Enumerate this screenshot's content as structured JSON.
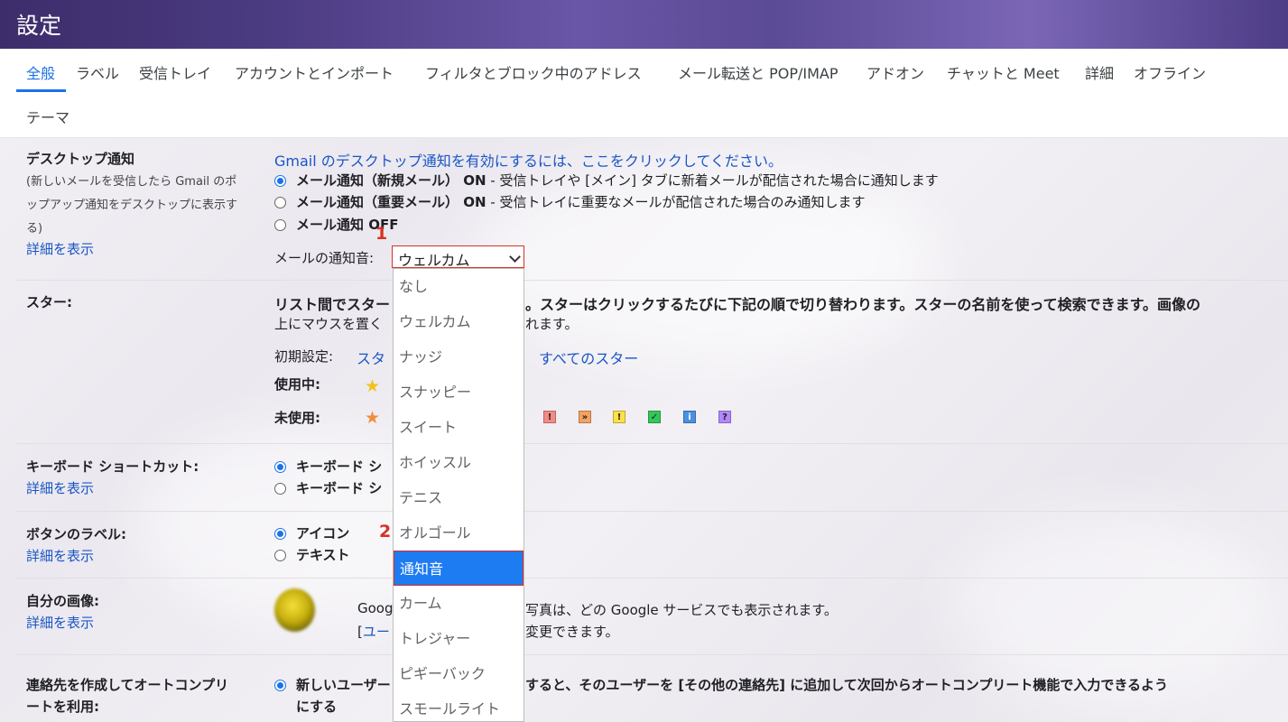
{
  "header": {
    "title": "設定"
  },
  "tabs": [
    "全般",
    "ラベル",
    "受信トレイ",
    "アカウントとインポート",
    "フィルタとブロック中のアドレス",
    "メール転送と POP/IMAP",
    "アドオン",
    "チャットと Meet",
    "詳細",
    "オフライン",
    "テーマ"
  ],
  "desktop": {
    "label": "デスクトップ通知",
    "desc1": "(新しいメールを受信したら Gmail のポ",
    "desc2": "ップアップ通知をデスクトップに表示す",
    "desc3": "る)",
    "more": "詳細を表示",
    "enable_link": "Gmail のデスクトップ通知を有効にするには、ここをクリックしてください。",
    "opt1_b": "メール通知（新規メール） ON",
    "opt1_t": " - 受信トレイや [メイン] タブに新着メールが配信された場合に通知します",
    "opt2_b": "メール通知（重要メール） ON",
    "opt2_t": " - 受信トレイに重要なメールが配信された場合のみ通知します",
    "opt3_b": "メール通知 OFF",
    "sound_label": "メールの通知音:",
    "sound_value": "ウェルカム"
  },
  "sound_options": [
    "なし",
    "ウェルカム",
    "ナッジ",
    "スナッピー",
    "スイート",
    "ホイッスル",
    "テニス",
    "オルゴール",
    "通知音",
    "カーム",
    "トレジャー",
    "ピギーバック",
    "スモールライト"
  ],
  "stars": {
    "label": "スター:",
    "line1a": "リスト間でスター",
    "line1b": "。スターはクリックするたびに下記の順で切り替わります。スターの名前を使って検索できます。画像の",
    "line2a": "上にマウスを置く",
    "line2b": "れます。",
    "preset": "初期設定:",
    "preset_link": "スタ",
    "all_stars": "すべてのスター",
    "in_use": "使用中:",
    "not_in_use": "未使用:"
  },
  "keyboard": {
    "label": "キーボード ショートカット:",
    "more": "詳細を表示",
    "opt1": "キーボード シ",
    "opt2": "キーボード シ"
  },
  "button_labels": {
    "label": "ボタンのラベル:",
    "more": "詳細を表示",
    "opt1": "アイコン",
    "opt2": "テキスト"
  },
  "picture": {
    "label": "自分の画像:",
    "more": "詳細を表示",
    "line1a": "Goog",
    "line1b": "写真は、どの Google サービスでも表示されます。",
    "line2a": "[",
    "line2link": "ユー",
    "line2b": "変更できます。"
  },
  "autocomplete": {
    "label1": "連絡先を作成してオートコンプリ",
    "label2": "ートを利用:",
    "opt1a": "新しいユーザー",
    "opt1b": "すると、そのユーザーを [その他の連絡先] に追加して次回からオートコンプリート機能で入力できるよう",
    "opt1c": "にする"
  },
  "markers": {
    "m1": "1",
    "m2": "2"
  },
  "colors": {
    "accent": "#1a73e8",
    "highlight": "#d93025",
    "selected": "#1e7cf2"
  }
}
